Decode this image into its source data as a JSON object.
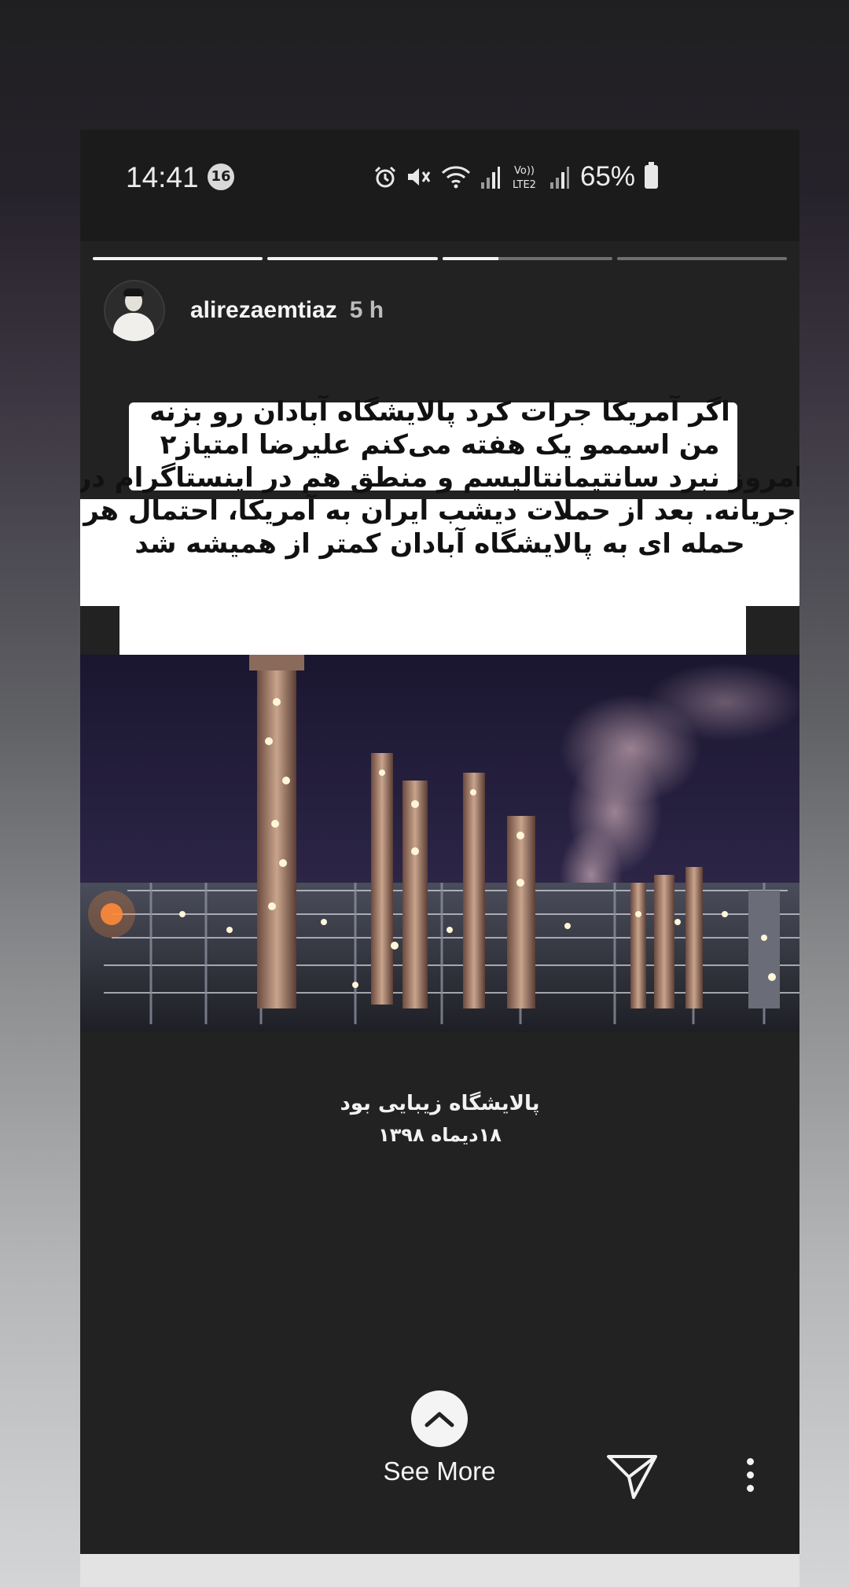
{
  "status_bar": {
    "time": "14:41",
    "notification_count": "16",
    "battery": "65%",
    "icons": [
      "alarm-icon",
      "mute-icon",
      "wifi-icon",
      "signal-icon",
      "volte-icon",
      "signal-icon",
      "battery-icon"
    ],
    "volte_label": "Vo))\nLTE2"
  },
  "story": {
    "segments": [
      1,
      1,
      0.33,
      0
    ],
    "username": "alirezaemtiaz",
    "age": "5 h",
    "caption_lines": [
      "اگر آمریکا جرات کرد پالایشگاه آبادان رو بزنه",
      "من اسممو یک هفته می‌کنم علیرضا امتیاز۲",
      "امروز نبرد سانتیمانتالیسم و منطق هم در اینستاگرام در",
      "جریانه. بعد از حملات دیشب ایران به آمریکا، احتمال هر",
      "حمله ای به پالایشگاه آبادان کمتر از همیشه شد"
    ],
    "photo_caption_line1": "پالایشگاه زیبایی بود",
    "photo_caption_line2": "۱۸دیماه ۱۳۹۸",
    "see_more_label": "See More"
  },
  "colors": {
    "story_bg": "#222223",
    "banner_bg": "#ffffff",
    "text_light": "#f4f4f4"
  }
}
